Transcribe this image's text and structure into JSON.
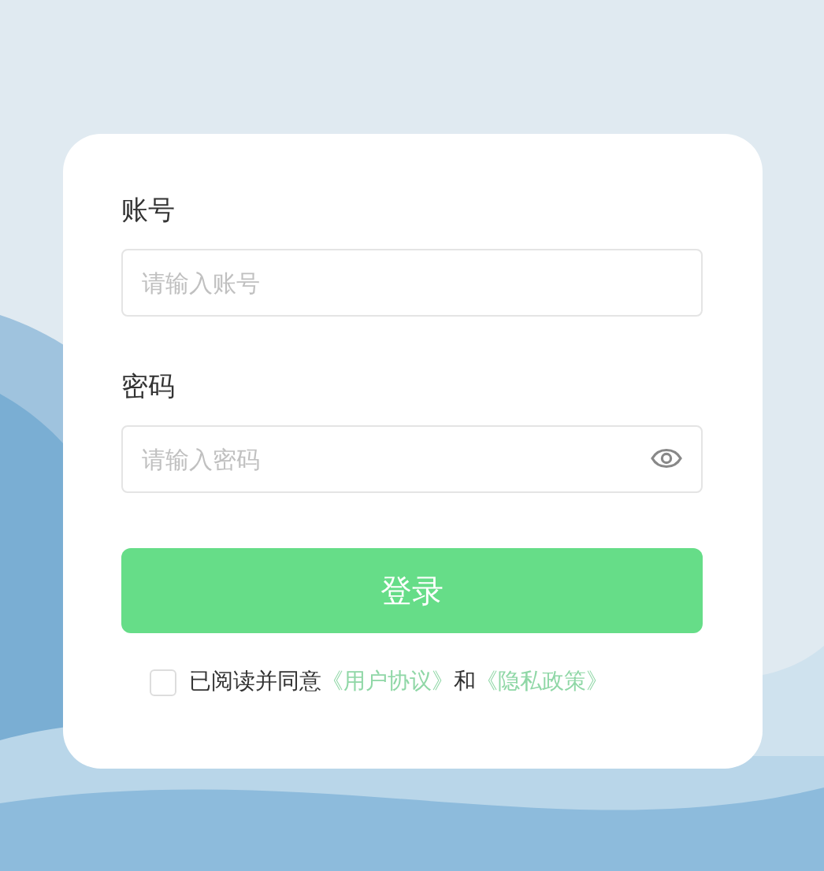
{
  "fields": [
    {
      "label": "账号",
      "placeholder": "请输入账号",
      "kind": "text"
    },
    {
      "label": "密码",
      "placeholder": "请输入密码",
      "kind": "password"
    }
  ],
  "login_button": "登录",
  "agreement": {
    "checked": false,
    "text_before": "已阅读并同意",
    "link_1": "《用户协议》",
    "connector": "和",
    "link_2": "《隐私政策》"
  }
}
